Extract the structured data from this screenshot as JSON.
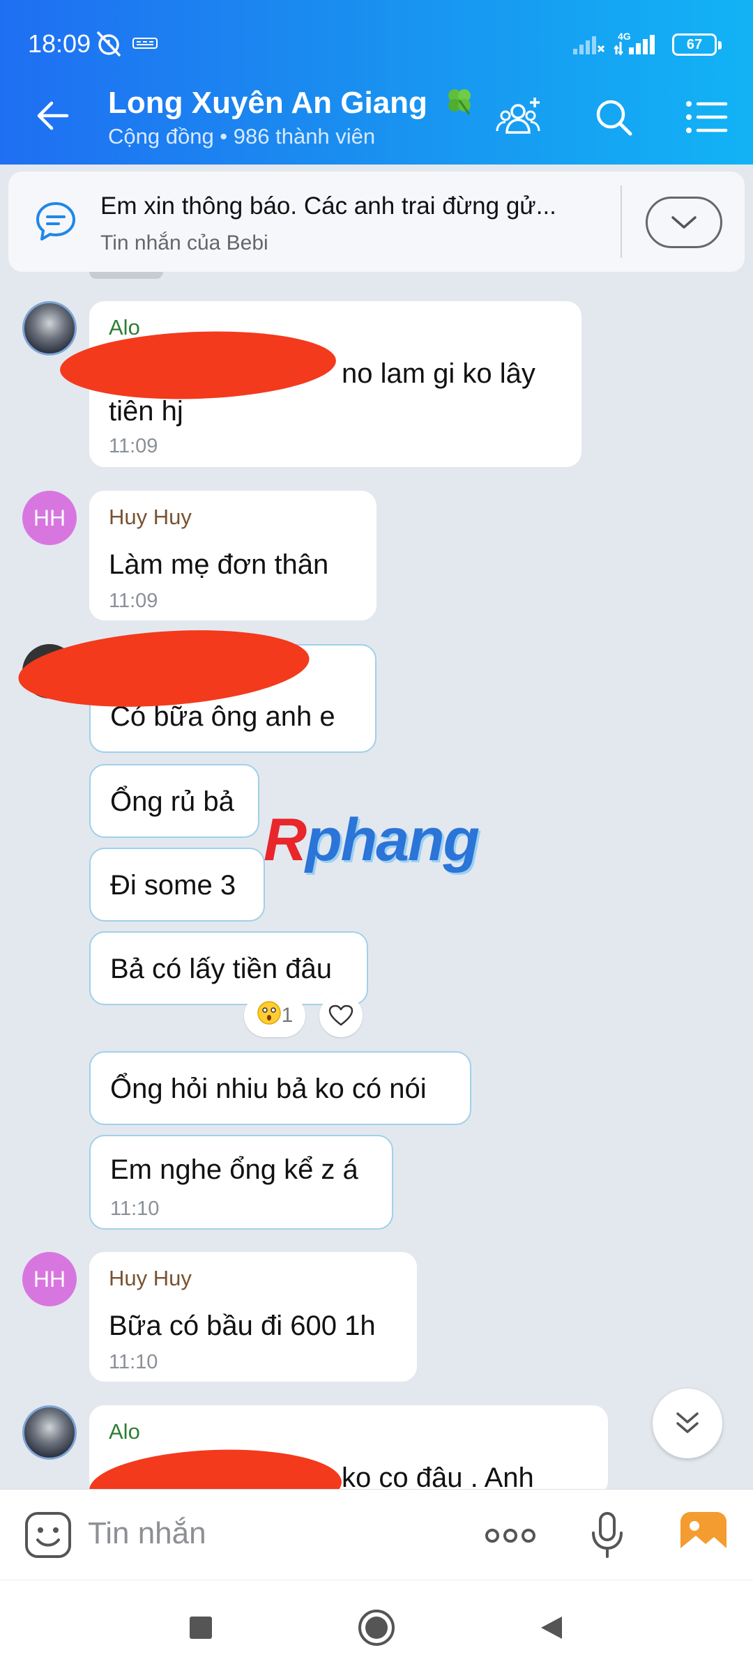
{
  "status_bar": {
    "time": "18:09",
    "battery": "67",
    "network": "4G"
  },
  "header": {
    "title": "Long Xuyên An Giang",
    "subtitle": "Cộng đồng • 986 thành viên"
  },
  "pinned": {
    "text": "Em xin thông báo. Các anh trai đừng gử...",
    "subtext": "Tin nhắn của Bebi"
  },
  "messages": [
    {
      "sender": "Alo",
      "text_line1": "no lam gi ko lây",
      "text_line2": "tiên hj",
      "time": "11:09"
    },
    {
      "avatar": "HH",
      "sender": "Huy Huy",
      "text": "Làm mẹ đơn thân",
      "time": "11:09"
    },
    {
      "text": "Có bữa ông anh e"
    },
    {
      "text": "Ổng rủ bả"
    },
    {
      "text": "Đi some 3"
    },
    {
      "text": "Bả có lấy tiền đâu",
      "reaction_count": "1"
    },
    {
      "text": "Ổng hỏi nhiu bả ko có nói"
    },
    {
      "text": "Em nghe ổng kể z á",
      "time": "11:10"
    },
    {
      "avatar": "HH",
      "sender": "Huy Huy",
      "text": "Bữa có bầu đi 600 1h",
      "time": "11:10"
    },
    {
      "sender": "Alo",
      "text": "ko co đâu . Anh"
    }
  ],
  "watermark": {
    "first": "R",
    "rest": "phang"
  },
  "input": {
    "placeholder": "Tin nhắn"
  },
  "colors": {
    "header_start": "#1f6ff2",
    "header_end": "#12b3f5",
    "sender_alo": "#2e7d32",
    "sender_huy": "#7a5230",
    "redaction": "#f33a1c"
  }
}
